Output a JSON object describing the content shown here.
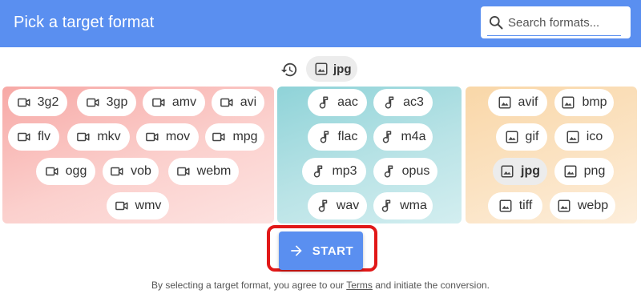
{
  "header": {
    "title": "Pick a target format",
    "search_placeholder": "Search formats...",
    "colors": {
      "header_bg": "#5a8ff0"
    }
  },
  "selected": {
    "format": "jpg",
    "history_icon": "history-icon",
    "format_icon": "image-icon"
  },
  "video_formats": [
    "3g2",
    "3gp",
    "amv",
    "avi",
    "flv",
    "mkv",
    "mov",
    "mpg",
    "ogg",
    "vob",
    "webm",
    "wmv"
  ],
  "audio_formats": [
    "aac",
    "ac3",
    "flac",
    "m4a",
    "mp3",
    "opus",
    "wav",
    "wma"
  ],
  "image_formats": [
    "avif",
    "bmp",
    "gif",
    "ico",
    "jpg",
    "png",
    "tiff",
    "webp"
  ],
  "icons": {
    "video": "video-camera-icon",
    "audio": "music-note-icon",
    "image": "image-icon"
  },
  "start_button": {
    "label": "START",
    "icon": "arrow-right-icon",
    "highlight_color": "#e11818"
  },
  "footer": {
    "text_before": "By selecting a target format, you agree to our ",
    "terms_link": "Terms",
    "text_after": " and initiate the conversion."
  }
}
